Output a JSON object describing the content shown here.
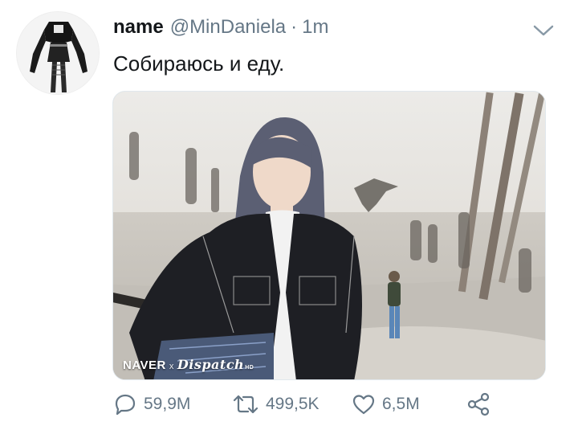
{
  "tweet": {
    "author_name": "name",
    "author_handle": "@MinDaniela",
    "separator": "·",
    "time": "1m",
    "text": "Собираюсь и еду."
  },
  "media": {
    "watermark_brand": "NAVER",
    "watermark_x": "x",
    "watermark_source": "Dispatch",
    "watermark_hd": "HD"
  },
  "actions": {
    "replies": "59,9M",
    "retweets": "499,5K",
    "likes": "6,5M"
  },
  "icons": {
    "menu": "chevron-down-icon",
    "reply": "comment-icon",
    "retweet": "retweet-icon",
    "like": "heart-icon",
    "share": "share-icon"
  },
  "colors": {
    "text": "#14171a",
    "secondary": "#657786",
    "border": "#e1e8ed"
  }
}
